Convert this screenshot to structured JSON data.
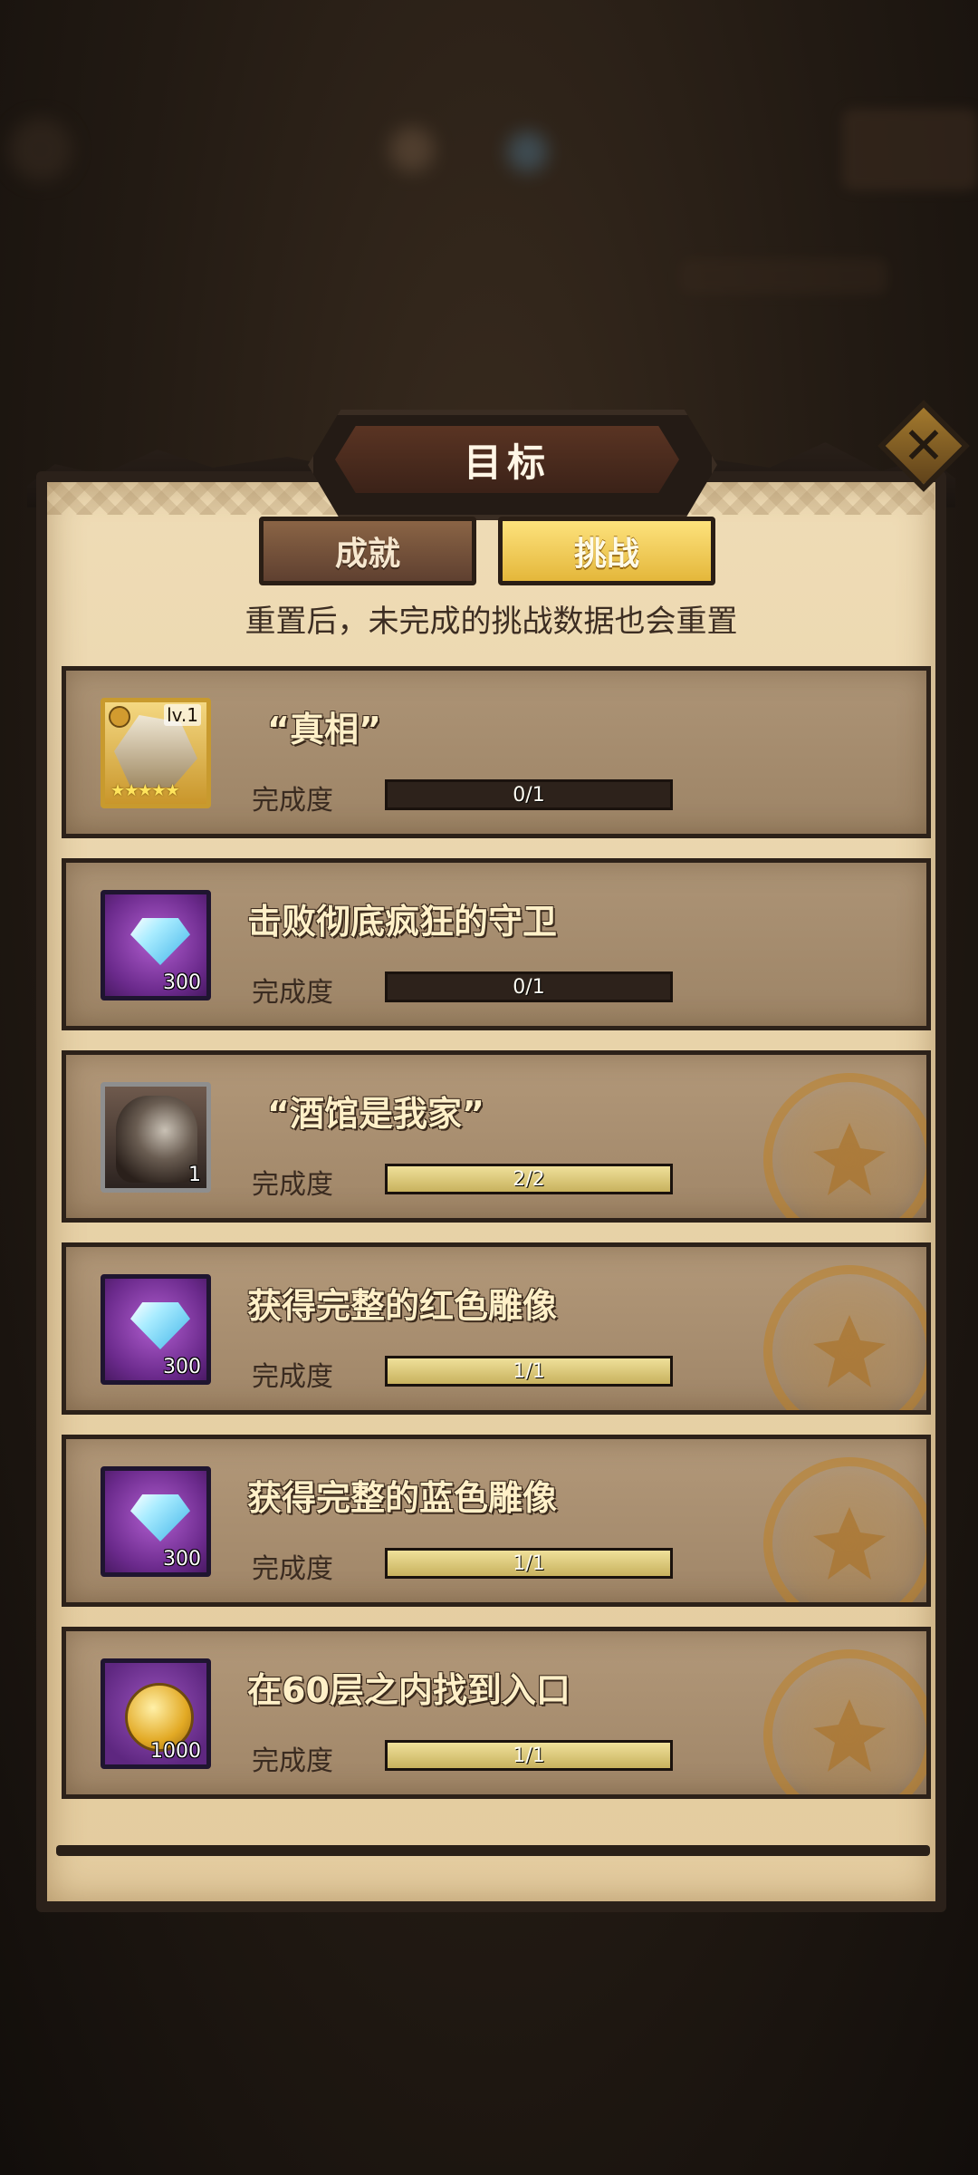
{
  "dialog": {
    "title": "目标",
    "close_icon": "close-x-icon",
    "tabs": [
      {
        "label": "成就",
        "selected": false
      },
      {
        "label": "挑战",
        "selected": true
      }
    ],
    "notice": "重置后，未完成的挑战数据也会重置"
  },
  "challenges": [
    {
      "title": "“真相”",
      "progress_label": "完成度",
      "progress_text": "0/1",
      "progress": 0.0,
      "reward": {
        "type": "hero-portrait",
        "level": "lv.1",
        "stars": "★★★★★",
        "quantity": ""
      },
      "completed": false
    },
    {
      "title": "击败彻底疯狂的守卫",
      "progress_label": "完成度",
      "progress_text": "0/1",
      "progress": 0.0,
      "reward": {
        "type": "diamond",
        "quantity": "300"
      },
      "completed": false
    },
    {
      "title": "“酒馆是我家”",
      "progress_label": "完成度",
      "progress_text": "2/2",
      "progress": 1.0,
      "reward": {
        "type": "hero-portrait-dark",
        "quantity": "1"
      },
      "completed": true
    },
    {
      "title": "获得完整的红色雕像",
      "progress_label": "完成度",
      "progress_text": "1/1",
      "progress": 1.0,
      "reward": {
        "type": "diamond",
        "quantity": "300"
      },
      "completed": true
    },
    {
      "title": "获得完整的蓝色雕像",
      "progress_label": "完成度",
      "progress_text": "1/1",
      "progress": 1.0,
      "reward": {
        "type": "diamond",
        "quantity": "300"
      },
      "completed": true
    },
    {
      "title": "在60层之内找到入口",
      "progress_label": "完成度",
      "progress_text": "1/1",
      "progress": 1.0,
      "reward": {
        "type": "gold-coin",
        "quantity": "1000"
      },
      "completed": true
    }
  ],
  "colors": {
    "paper": "#e8d3a9",
    "row_bg": "#a58c6e",
    "frame": "#2b211a",
    "tab_selected": "#f0c64e",
    "bar_fill": "#dccb7c"
  }
}
